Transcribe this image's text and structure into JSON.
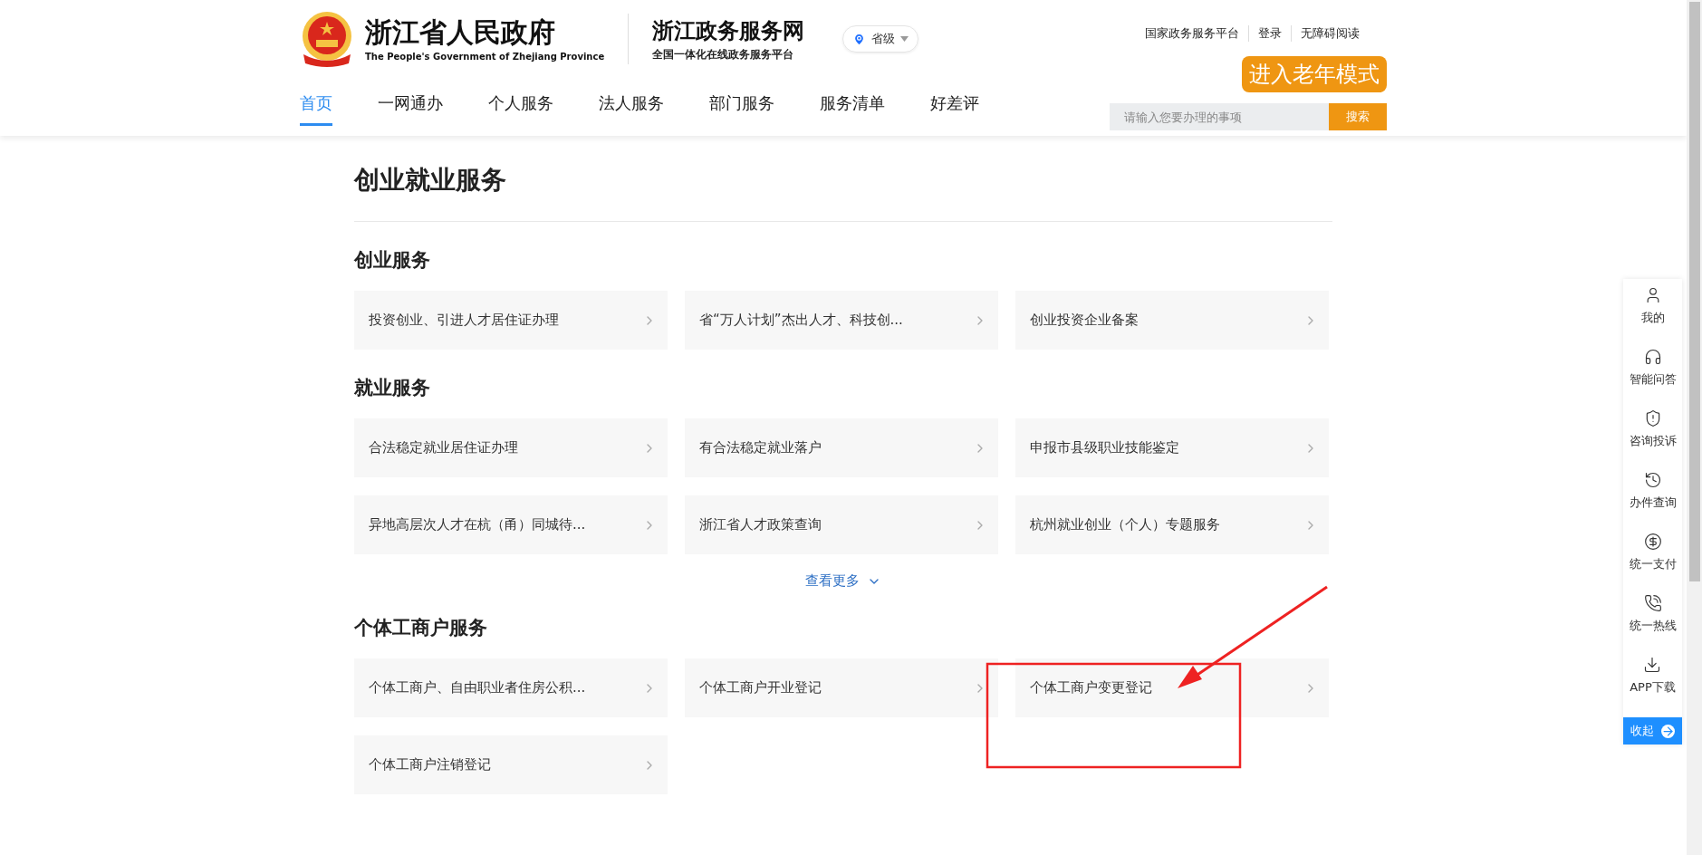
{
  "header": {
    "site_name": "浙江省人民政府",
    "site_name_en": "The People's Government of Zhejiang Province",
    "portal_name": "浙江政务服务网",
    "portal_subtitle": "全国一体化在线政务服务平台",
    "region_selector": {
      "label": "省级"
    },
    "top_links": [
      "国家政务服务平台",
      "登录",
      "无障碍阅读"
    ],
    "elder_mode_button": "进入老年模式",
    "nav": [
      {
        "label": "首页",
        "selected": true
      },
      {
        "label": "一网通办",
        "selected": false
      },
      {
        "label": "个人服务",
        "selected": false
      },
      {
        "label": "法人服务",
        "selected": false
      },
      {
        "label": "部门服务",
        "selected": false
      },
      {
        "label": "服务清单",
        "selected": false
      },
      {
        "label": "好差评",
        "selected": false
      }
    ],
    "search": {
      "placeholder": "请输入您要办理的事项",
      "button": "搜索"
    }
  },
  "page_title": "创业就业服务",
  "sections": [
    {
      "title": "创业服务",
      "items": [
        "投资创业、引进人才居住证办理",
        "省“万人计划”杰出人才、科技创...",
        "创业投资企业备案"
      ]
    },
    {
      "title": "就业服务",
      "items": [
        "合法稳定就业居住证办理",
        "有合法稳定就业落户",
        "申报市县级职业技能鉴定",
        "异地高层次人才在杭（甬）同城待...",
        "浙江省人才政策查询",
        "杭州就业创业（个人）专题服务"
      ],
      "more_link": "查看更多"
    },
    {
      "title": "个体工商户服务",
      "items": [
        "个体工商户、自由职业者住房公积...",
        "个体工商户开业登记",
        "个体工商户变更登记",
        "个体工商户注销登记"
      ]
    }
  ],
  "sidebar": {
    "items": [
      {
        "kind": "user",
        "label": "我的"
      },
      {
        "kind": "headset",
        "label": "智能问答"
      },
      {
        "kind": "shield",
        "label": "咨询投诉"
      },
      {
        "kind": "history",
        "label": "办件查询"
      },
      {
        "kind": "yuan",
        "label": "统一支付"
      },
      {
        "kind": "phone",
        "label": "统一热线"
      },
      {
        "kind": "download",
        "label": "APP下载"
      }
    ],
    "collapse_button": "收起"
  }
}
